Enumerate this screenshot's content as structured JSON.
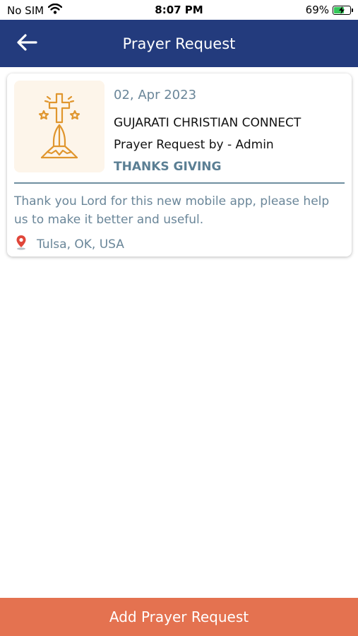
{
  "status_bar": {
    "carrier": "No SIM",
    "time": "8:07 PM",
    "battery_percent": "69%",
    "battery_level": 0.69,
    "icons": [
      "wifi-icon",
      "battery-charging-icon"
    ]
  },
  "header": {
    "title": "Prayer Request",
    "back_icon": "arrow-left-icon",
    "color": "#233b7d"
  },
  "prayer_requests": [
    {
      "date": "02, Apr 2023",
      "organization": "GUJARATI CHRISTIAN CONNECT",
      "requested_by": "Prayer Request by - Admin",
      "category": "THANKS GIVING",
      "message": "Thank you Lord for this new mobile app, please help us to make it better and useful.",
      "location": "Tulsa, OK, USA",
      "thumbnail_icon": "praying-hands-cross-icon",
      "location_icon": "map-pin-icon"
    }
  ],
  "footer": {
    "add_button_label": "Add Prayer Request",
    "color": "#e47250"
  }
}
